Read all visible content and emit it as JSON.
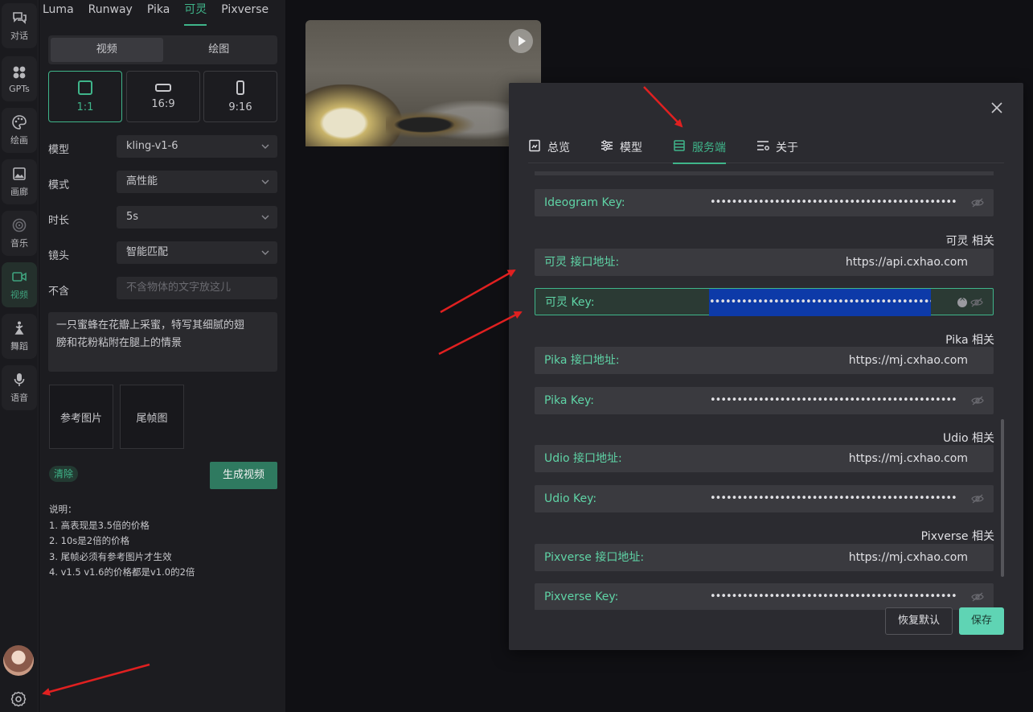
{
  "rail": {
    "items": [
      {
        "label": "对话",
        "icon": "chat-icon"
      },
      {
        "label": "GPTs",
        "icon": "apps-icon"
      },
      {
        "label": "绘画",
        "icon": "palette-icon"
      },
      {
        "label": "画廊",
        "icon": "image-icon"
      },
      {
        "label": "音乐",
        "icon": "music-icon"
      },
      {
        "label": "视频",
        "icon": "video-icon"
      },
      {
        "label": "舞蹈",
        "icon": "dance-icon"
      },
      {
        "label": "语音",
        "icon": "mic-icon"
      }
    ],
    "active": "视频"
  },
  "panel": {
    "provider_tabs": [
      "Luma",
      "Runway",
      "Pika",
      "可灵",
      "Pixverse"
    ],
    "active_provider": "可灵",
    "mode_tabs": [
      "视频",
      "绘图"
    ],
    "ratios": [
      "1:1",
      "16:9",
      "9:16"
    ],
    "fields": {
      "model": {
        "label": "模型",
        "value": "kling-v1-6"
      },
      "mode": {
        "label": "模式",
        "value": "高性能"
      },
      "duration": {
        "label": "时长",
        "value": "5s"
      },
      "camera": {
        "label": "镜头",
        "value": "智能匹配"
      },
      "negative": {
        "label": "不含",
        "placeholder": "不含物体的文字放这儿"
      }
    },
    "prompt_line1": "一只蜜蜂在花瓣上采蜜，特写其细腻的翅",
    "prompt_line2": "膀和花粉粘附在腿上的情景",
    "ref_image": "参考图片",
    "end_frame": "尾帧图",
    "clear": "清除",
    "generate": "生成视频",
    "notes": [
      "说明：",
      "1. 高表现是3.5倍的价格",
      "2. 10s是2倍的价格",
      "3. 尾帧必须有参考图片才生效",
      "4. v1.5 v1.6的价格都是v1.0的2倍"
    ]
  },
  "dialog": {
    "tabs": [
      {
        "label": "总览",
        "icon": "overview-icon"
      },
      {
        "label": "模型",
        "icon": "sliders-icon"
      },
      {
        "label": "服务端",
        "icon": "server-icon"
      },
      {
        "label": "关于",
        "icon": "about-icon"
      }
    ],
    "active_tab": "服务端",
    "masked": "••••••••••••••••••••••••••••••••••••••••••••••••••",
    "ideogram_key": "Ideogram Key:",
    "kling_section": "可灵 相关",
    "kling_url_label": "可灵 接口地址:",
    "kling_url": "https://api.cxhao.com",
    "kling_key_label": "可灵 Key:",
    "pika_section": "Pika 相关",
    "pika_url_label": "Pika 接口地址:",
    "pika_url": "https://mj.cxhao.com",
    "pika_key_label": "Pika Key:",
    "udio_section": "Udio 相关",
    "udio_url_label": "Udio 接口地址:",
    "udio_url": "https://mj.cxhao.com",
    "udio_key_label": "Udio Key:",
    "pixverse_section": "Pixverse 相关",
    "pixverse_url_label": "Pixverse 接口地址:",
    "pixverse_url": "https://mj.cxhao.com",
    "pixverse_key_label": "Pixverse Key:",
    "reset": "恢复默认",
    "save": "保存"
  },
  "colors": {
    "accent": "#3fb58a",
    "label_green": "#5fd4a6",
    "arrow_red": "#e02020",
    "selection": "#0d3aa8"
  }
}
